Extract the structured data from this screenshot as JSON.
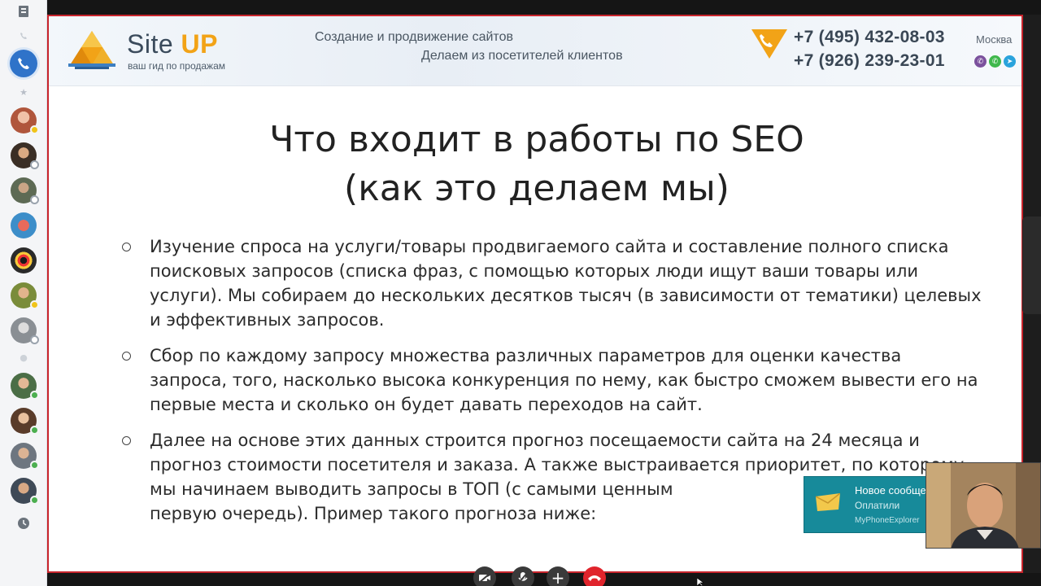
{
  "banner": {
    "logo_site": "Site",
    "logo_up": "UP",
    "logo_sub": "ваш гид по продажам",
    "tagline1": "Создание и продвижение сайтов",
    "tagline2": "Делаем из посетителей клиентов",
    "phone1": "+7 (495) 432-08-03",
    "phone2": "+7 (926) 239-23-01",
    "city": "Москва",
    "messengers": [
      "viber-icon",
      "whatsapp-icon",
      "telegram-icon"
    ]
  },
  "slide": {
    "title_line1": "Что входит в работы по SEO",
    "title_line2": "(как это делаем мы)",
    "bullets": [
      "Изучение спроса на услуги/товары продвигаемого сайта и составление полного списка поисковых запросов (списка фраз, с помощью которых люди ищут ваши товары или услуги). Мы собираем до нескольких десятков тысяч (в зависимости от тематики) целевых и эффективных запросов.",
      "Сбор по каждому запросу множества различных параметров для оценки качества запроса, того, насколько высока конкуренция по нему, как быстро сможем вывести его на первые места и сколько он будет давать переходов на сайт.",
      "Далее на основе этих данных строится прогноз посещаемости сайта на 24 месяца и прогноз стоимости посетителя и заказа. А также выстраивается приоритет, по которому мы начинаем выводить запросы в ТОП (с самыми ценным",
      "первую очередь). Пример такого прогноза ниже:"
    ]
  },
  "toast": {
    "title": "Новое сообще",
    "text": "Оплатили",
    "app": "MyPhoneExplorer"
  },
  "colors": {
    "accent_red": "#c8242c",
    "call_blue": "#2f73c9",
    "hangup_red": "#e0242c",
    "logo_orange": "#f2a317"
  }
}
